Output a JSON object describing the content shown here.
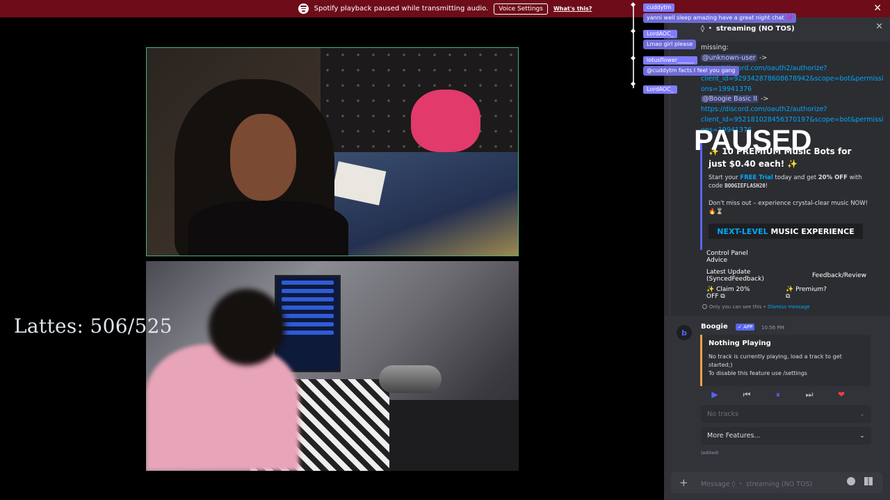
{
  "banner": {
    "message": "Spotify playback paused while transmitting audio.",
    "voice_settings": "Voice Settings",
    "whats_this": "What's this?",
    "close": "✕",
    "color": "#6e0c19"
  },
  "overlay": {
    "lattes": "Lattes: 506/525",
    "paused": "PAUSED"
  },
  "chat_overlay": {
    "usernames": [
      "cuddytm",
      "LordAOC_",
      "lotusflower______",
      "LordAOC_"
    ],
    "messages": [
      "yanni well sleep amazing have a great night chat 💜",
      "Lmao girl please",
      "@cuddytm facts I feel you gang"
    ],
    "accent": "#7f7bff"
  },
  "discord": {
    "channel_title": "◊ ・ streaming (NO TOS)",
    "close": "✕",
    "missing_label": "missing:",
    "mention1": "@unknown-user",
    "arrow": "->",
    "link1a": "https://discord.com/oauth2/authorize?",
    "link1b": "client_id=929342878608678942&scope=bot&permissi",
    "link1c": "ons=19941376",
    "mention2": "@Boogie Basic II",
    "link2a": "https://discord.com/oauth2/authorize?",
    "link2b": "client_id=952181028456370197&scope=bot&permissi",
    "link2c": "ons=19941376",
    "embed": {
      "heading": "✨ 10 PREMIUM Music Bots for just $0.40 each! ✨",
      "line1_pre": "Start your ",
      "line1_free": "FREE Trial",
      "line1_mid": " today and get ",
      "line1_off": "20% OFF",
      "line1_post": " with",
      "line2_pre": "code ",
      "line2_code": "BOOGIEFLASH20",
      "line2_post": "!",
      "line3": "Don't miss out – experience crystal-clear music NOW!",
      "line4": "🔥⌛",
      "cta_hl": "NEXT-LEVEL",
      "cta": "MUSIC EXPERIENCE"
    },
    "buttons": {
      "control_panel": "Control Panel Advice",
      "latest_update": "Latest Update (SyncedFeedback)",
      "feedback": "Feedback/Review",
      "claim": "✨ Claim 20% OFF ⧉",
      "premium": "✨ Premium? ⧉"
    },
    "ephemeral": "Only you can see this • ",
    "dismiss": "Dismiss message",
    "boogie": {
      "avatar": "b",
      "author": "Boogie",
      "app_tag": "✓ APP",
      "timestamp": "10:56 PM",
      "np_title": "Nothing Playing",
      "np_line1": "No track is currently playing, load a track to get",
      "np_line2": "started;)",
      "np_line3": "To disable this feature use /settings",
      "controls": [
        "▶",
        "⏮",
        "⏸",
        "⏭",
        "❤"
      ],
      "no_tracks": "No tracks",
      "more_features": "More Features...",
      "edited": "(edited)"
    },
    "input_placeholder": "Message ◊ ・ streaming (NO TOS)",
    "plus": "+"
  }
}
